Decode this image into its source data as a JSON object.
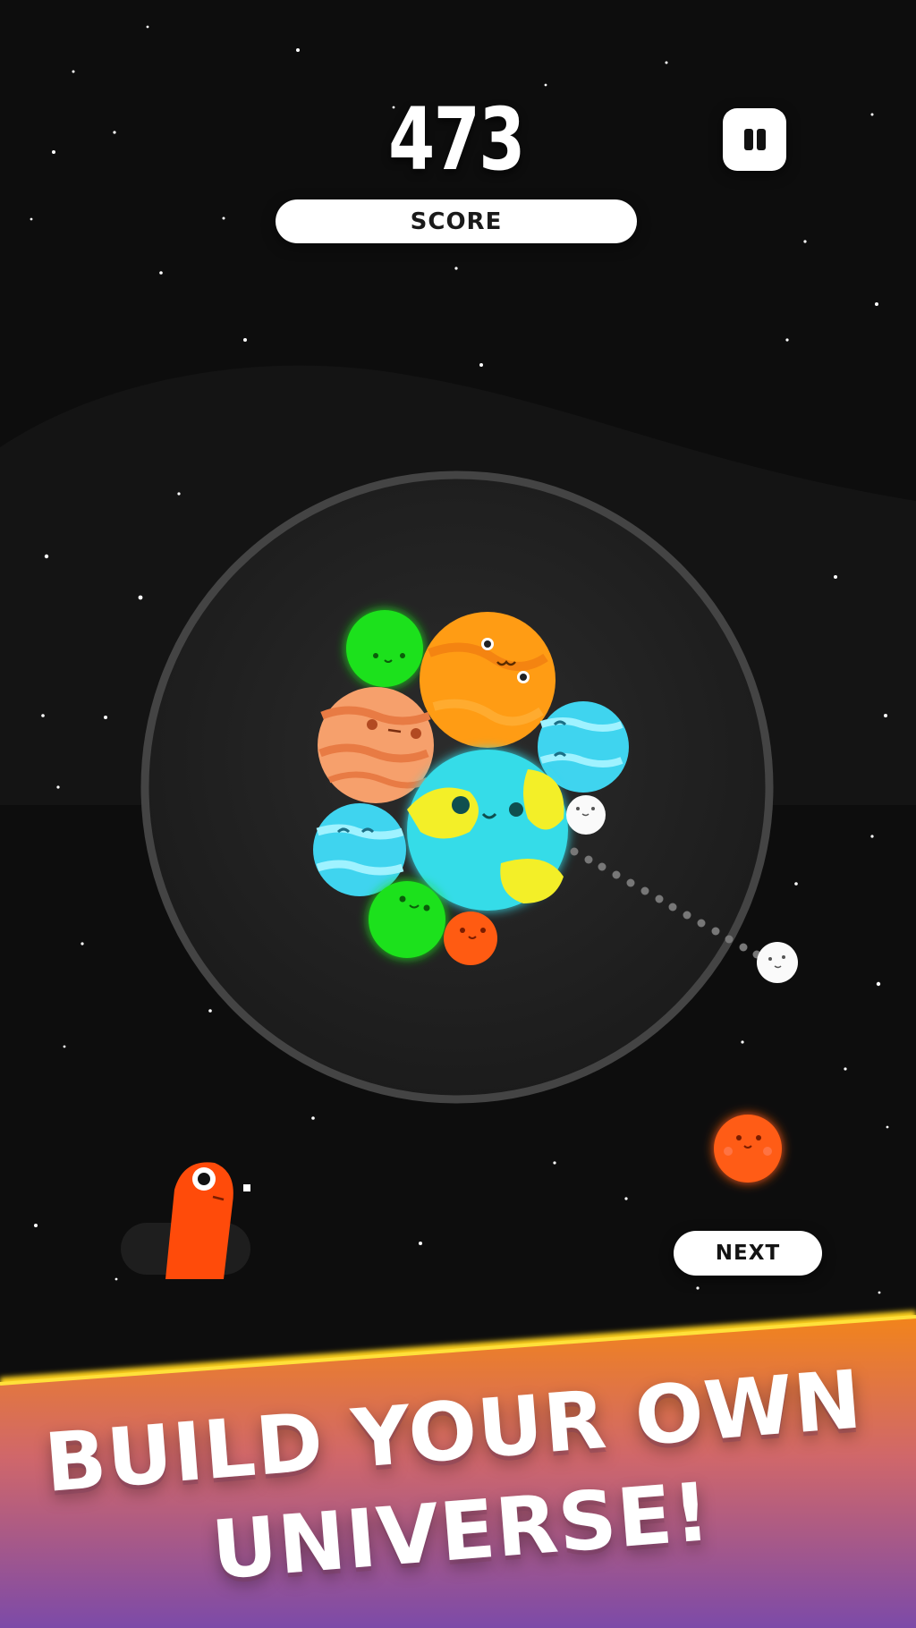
{
  "hud": {
    "score_value": "473",
    "score_label": "SCORE",
    "pause_icon": "pause-icon"
  },
  "controls": {
    "next_label": "NEXT"
  },
  "banner": {
    "line1": "BUILD YOUR OWN",
    "line2": "UNIVERSE!"
  },
  "colors": {
    "background": "#0d0d0d",
    "ring": "#3a3a3a",
    "earth_ocean": "#36dde8",
    "earth_land": "#f4f02a",
    "green_planet": "#1ee01a",
    "orange_planet": "#ff9d15",
    "jupiter": "#f7a26f",
    "neptune": "#3fd5ee",
    "mars": "#ff5a12",
    "moon": "#ffffff",
    "banner_top": "#f0841e",
    "banner_bottom": "#7a4aa8"
  }
}
